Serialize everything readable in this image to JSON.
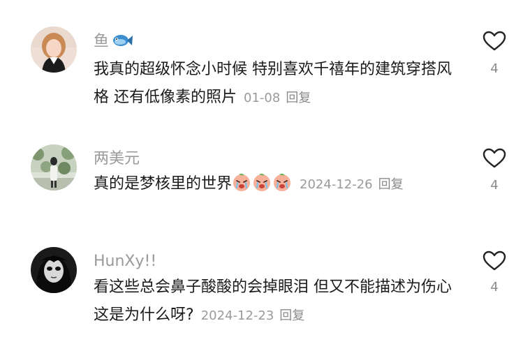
{
  "comments": [
    {
      "username": "鱼",
      "username_icon": "fish-emoji-icon",
      "text": "我真的超级怀念小时候 特别喜欢千禧年的建筑穿搭风格 还有低像素的照片",
      "date": "01-08",
      "reply_label": "回复",
      "likes": "4"
    },
    {
      "username": "两美元",
      "text": "真的是梦核里的世界",
      "emojis": [
        "crying-peach-emoji-icon",
        "crying-peach-emoji-icon",
        "crying-peach-emoji-icon"
      ],
      "date": "2024-12-26",
      "reply_label": "回复",
      "likes": "4"
    },
    {
      "username": "HunXy!!",
      "text": "看这些总会鼻子酸酸的会掉眼泪 但又不能描述为伤心 这是为什么呀?",
      "date": "2024-12-23",
      "reply_label": "回复",
      "likes": "4"
    }
  ],
  "colors": {
    "username": "#9a9a9a",
    "text": "#1a1a1a",
    "meta": "#9a9a9a",
    "heart_outline": "#222222",
    "peach_emoji": "#f4a48a"
  }
}
